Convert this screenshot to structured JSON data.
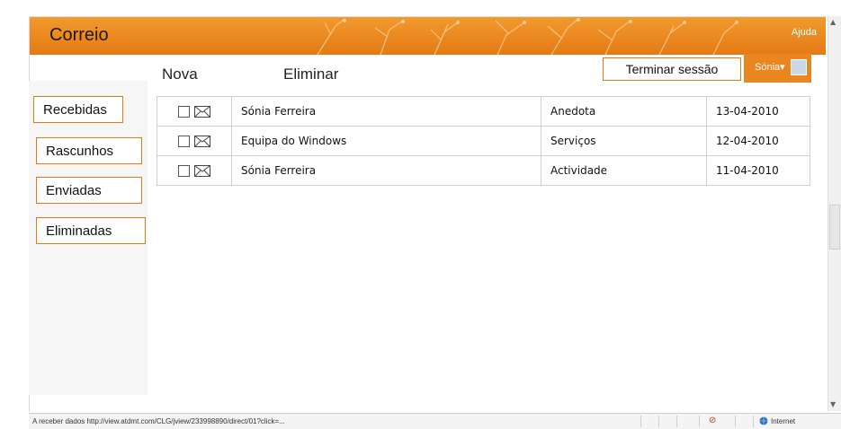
{
  "app": {
    "title": "Correio",
    "help_label": "Ajuda"
  },
  "toolbar": {
    "new_label": "Nova",
    "delete_label": "Eliminar",
    "signout_label": "Terminar sessão"
  },
  "user": {
    "name": "Sónia"
  },
  "folders": [
    "Recebidas",
    "Rascunhos",
    "Enviadas",
    "Eliminadas"
  ],
  "messages": [
    {
      "from": "Sónia Ferreira",
      "subject": "Anedota",
      "date": "13-04-2010"
    },
    {
      "from": "Equipa do Windows",
      "subject": "Serviços",
      "date": "12-04-2010"
    },
    {
      "from": "Sónia Ferreira",
      "subject": "Actividade",
      "date": "11-04-2010"
    }
  ],
  "status": {
    "text": "A receber dados http://view.atdmt.com/CLG/jview/233998890/direct/01?click=...",
    "zone": "Internet"
  },
  "colors": {
    "accent": "#e57a14",
    "header_light": "#f19a2e"
  },
  "icons": [
    "envelope-icon",
    "checkbox-icon",
    "avatar-icon",
    "globe-icon",
    "dropdown-arrow-icon"
  ]
}
